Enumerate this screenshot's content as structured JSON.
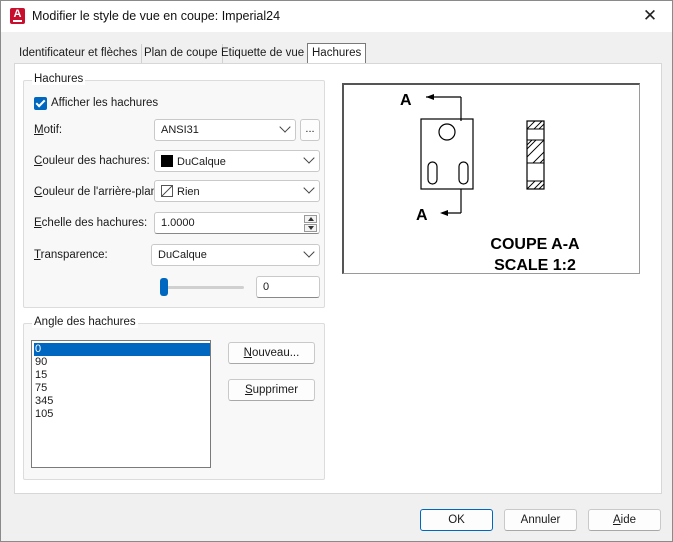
{
  "window": {
    "title": "Modifier le style de vue en coupe: Imperial24"
  },
  "tabs": [
    {
      "label": "Identificateur et flèches"
    },
    {
      "label": "Plan de coupe"
    },
    {
      "label": "Etiquette de vue"
    },
    {
      "label": "Hachures"
    }
  ],
  "hatch": {
    "group_title": "Hachures",
    "show_hatch_label": "Afficher les hachures",
    "show_hatch_checked": true,
    "pattern": {
      "label_u": "M",
      "label_rest": "otif:",
      "value": "ANSI31",
      "browse": "..."
    },
    "hatch_color": {
      "label_u": "C",
      "label_rest": "ouleur des hachures:",
      "value": "DuCalque"
    },
    "bg_color": {
      "label_u": "C",
      "label_rest": "ouleur de l'arrière-plan:",
      "value": "Rien"
    },
    "scale": {
      "label_u": "E",
      "label_rest": "chelle des hachures:",
      "value": "1.0000"
    },
    "transparency": {
      "label_u": "T",
      "label_rest": "ransparence:",
      "value": "DuCalque"
    },
    "transparency_value": "0",
    "transparency_level": 0
  },
  "angle": {
    "group_title": "Angle des hachures",
    "items": [
      "0",
      "90",
      "15",
      "75",
      "345",
      "105"
    ],
    "selected": "0",
    "new_button": {
      "u": "N",
      "rest": "ouveau..."
    },
    "delete_button": {
      "u": "S",
      "rest": "upprimer"
    }
  },
  "preview": {
    "label_top": "A",
    "label_bottom": "A",
    "caption_line1": "COUPE A-A",
    "caption_line2": "SCALE 1:2"
  },
  "footer": {
    "ok": "OK",
    "cancel": "Annuler",
    "help_u": "A",
    "help_rest": "ide"
  },
  "colors": {
    "accent": "#0067c0",
    "app_icon": "#c8102e"
  }
}
